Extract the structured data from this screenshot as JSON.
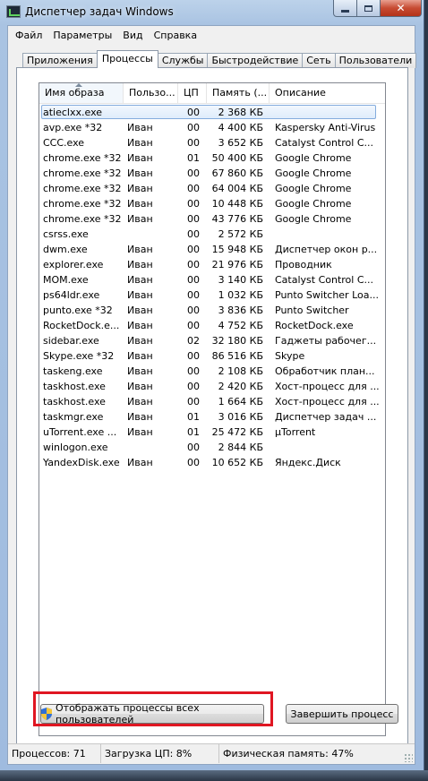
{
  "window": {
    "title": "Диспетчер задач Windows"
  },
  "menu": [
    "Файл",
    "Параметры",
    "Вид",
    "Справка"
  ],
  "tabs": [
    "Приложения",
    "Процессы",
    "Службы",
    "Быстродействие",
    "Сеть",
    "Пользователи"
  ],
  "active_tab": 1,
  "columns": [
    "Имя образа",
    "Пользо...",
    "ЦП",
    "Память (...",
    "Описание"
  ],
  "processes": [
    {
      "name": "atieclxx.exe",
      "user": "",
      "cpu": "00",
      "mem": "2 368 КБ",
      "desc": ""
    },
    {
      "name": "avp.exe *32",
      "user": "Иван",
      "cpu": "00",
      "mem": "4 400 КБ",
      "desc": "Kaspersky Anti-Virus"
    },
    {
      "name": "CCC.exe",
      "user": "Иван",
      "cpu": "00",
      "mem": "3 652 КБ",
      "desc": "Catalyst Control C..."
    },
    {
      "name": "chrome.exe *32",
      "user": "Иван",
      "cpu": "01",
      "mem": "50 400 КБ",
      "desc": "Google Chrome"
    },
    {
      "name": "chrome.exe *32",
      "user": "Иван",
      "cpu": "00",
      "mem": "67 860 КБ",
      "desc": "Google Chrome"
    },
    {
      "name": "chrome.exe *32",
      "user": "Иван",
      "cpu": "00",
      "mem": "64 004 КБ",
      "desc": "Google Chrome"
    },
    {
      "name": "chrome.exe *32",
      "user": "Иван",
      "cpu": "00",
      "mem": "10 448 КБ",
      "desc": "Google Chrome"
    },
    {
      "name": "chrome.exe *32",
      "user": "Иван",
      "cpu": "00",
      "mem": "43 776 КБ",
      "desc": "Google Chrome"
    },
    {
      "name": "csrss.exe",
      "user": "",
      "cpu": "00",
      "mem": "2 572 КБ",
      "desc": ""
    },
    {
      "name": "dwm.exe",
      "user": "Иван",
      "cpu": "00",
      "mem": "15 948 КБ",
      "desc": "Диспетчер окон р..."
    },
    {
      "name": "explorer.exe",
      "user": "Иван",
      "cpu": "00",
      "mem": "21 976 КБ",
      "desc": "Проводник"
    },
    {
      "name": "MOM.exe",
      "user": "Иван",
      "cpu": "00",
      "mem": "3 140 КБ",
      "desc": "Catalyst Control C..."
    },
    {
      "name": "ps64ldr.exe",
      "user": "Иван",
      "cpu": "00",
      "mem": "1 032 КБ",
      "desc": "Punto Switcher Loa..."
    },
    {
      "name": "punto.exe *32",
      "user": "Иван",
      "cpu": "00",
      "mem": "3 836 КБ",
      "desc": "Punto Switcher"
    },
    {
      "name": "RocketDock.e...",
      "user": "Иван",
      "cpu": "00",
      "mem": "4 752 КБ",
      "desc": "RocketDock.exe"
    },
    {
      "name": "sidebar.exe",
      "user": "Иван",
      "cpu": "02",
      "mem": "32 180 КБ",
      "desc": "Гаджеты рабочег..."
    },
    {
      "name": "Skype.exe *32",
      "user": "Иван",
      "cpu": "00",
      "mem": "86 516 КБ",
      "desc": "Skype"
    },
    {
      "name": "taskeng.exe",
      "user": "Иван",
      "cpu": "00",
      "mem": "2 108 КБ",
      "desc": "Обработчик план..."
    },
    {
      "name": "taskhost.exe",
      "user": "Иван",
      "cpu": "00",
      "mem": "2 420 КБ",
      "desc": "Хост-процесс для ..."
    },
    {
      "name": "taskhost.exe",
      "user": "Иван",
      "cpu": "00",
      "mem": "1 664 КБ",
      "desc": "Хост-процесс для ..."
    },
    {
      "name": "taskmgr.exe",
      "user": "Иван",
      "cpu": "01",
      "mem": "3 016 КБ",
      "desc": "Диспетчер задач ..."
    },
    {
      "name": "uTorrent.exe ...",
      "user": "Иван",
      "cpu": "01",
      "mem": "25 472 КБ",
      "desc": "µTorrent"
    },
    {
      "name": "winlogon.exe",
      "user": "",
      "cpu": "00",
      "mem": "2 844 КБ",
      "desc": ""
    },
    {
      "name": "YandexDisk.exe",
      "user": "Иван",
      "cpu": "00",
      "mem": "10 652 КБ",
      "desc": "Яндекс.Диск"
    }
  ],
  "selected_row": 0,
  "buttons": {
    "show_all": "Отображать процессы всех пользователей",
    "end_process": "Завершить процесс"
  },
  "status": {
    "processes": "Процессов: 71",
    "cpu": "Загрузка ЦП: 8%",
    "memory": "Физическая память: 47%"
  }
}
